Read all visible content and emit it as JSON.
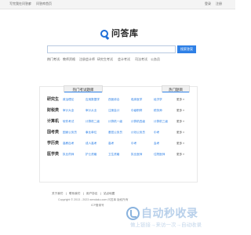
{
  "topbar": {
    "left_links": [
      "写完我在问答库",
      "问答库首页"
    ],
    "right_links": [
      "登录",
      "注册"
    ]
  },
  "logo": {
    "text": "问答库"
  },
  "search": {
    "placeholder": "",
    "button_label": "搜索答案"
  },
  "hot": {
    "label": "热门考试:",
    "items": [
      "教师资格",
      "注册会计师",
      "研究生考试",
      "会计考试",
      "司法考试",
      "公务员"
    ]
  },
  "tabs": {
    "left": "热门考试题库",
    "right": "热门题目"
  },
  "rows": [
    {
      "label": "研究生",
      "links": [
        "政治理论",
        "应用数据学",
        "西医综合",
        "临床医学",
        "经济学"
      ],
      "more": "更多 »"
    },
    {
      "label": "财税类",
      "links": [
        "审计大全",
        "审计从业",
        "注册会计",
        "中级职称",
        "税务师"
      ],
      "more": "更多 »"
    },
    {
      "label": "计算机",
      "links": [
        "软件考试",
        "计算机二级",
        "计算机一级",
        "计算机四级",
        "计算机三级"
      ],
      "more": "更多 »"
    },
    {
      "label": "国考类",
      "links": [
        "国家公务员",
        "事业单位",
        "基层公务员",
        "计划公务员",
        "中考"
      ],
      "more": "更多 »"
    },
    {
      "label": "学历类",
      "links": [
        "高教自考",
        "成人高考",
        "高考",
        "中考",
        "会考"
      ],
      "more": "更多 »"
    },
    {
      "label": "医学类",
      "links": [
        "执业药师",
        "护士资格",
        "卫生资格",
        "执业医师",
        "住院医师"
      ],
      "more": "更多 »"
    }
  ],
  "footer": {
    "links": [
      "关于我们",
      "联系我们",
      "用户协议",
      "站点地图"
    ],
    "copyright": "Copyright © 2013 - 2023 wendaku.com 问答库 版权所有",
    "icp": "ICP备案号"
  },
  "watermark": {
    "title": "自动秒收录",
    "subtitle": "做上链接→来访一次→自动收录"
  },
  "colors": {
    "accent": "#2e80e6",
    "logo": "#1f6fd8"
  }
}
